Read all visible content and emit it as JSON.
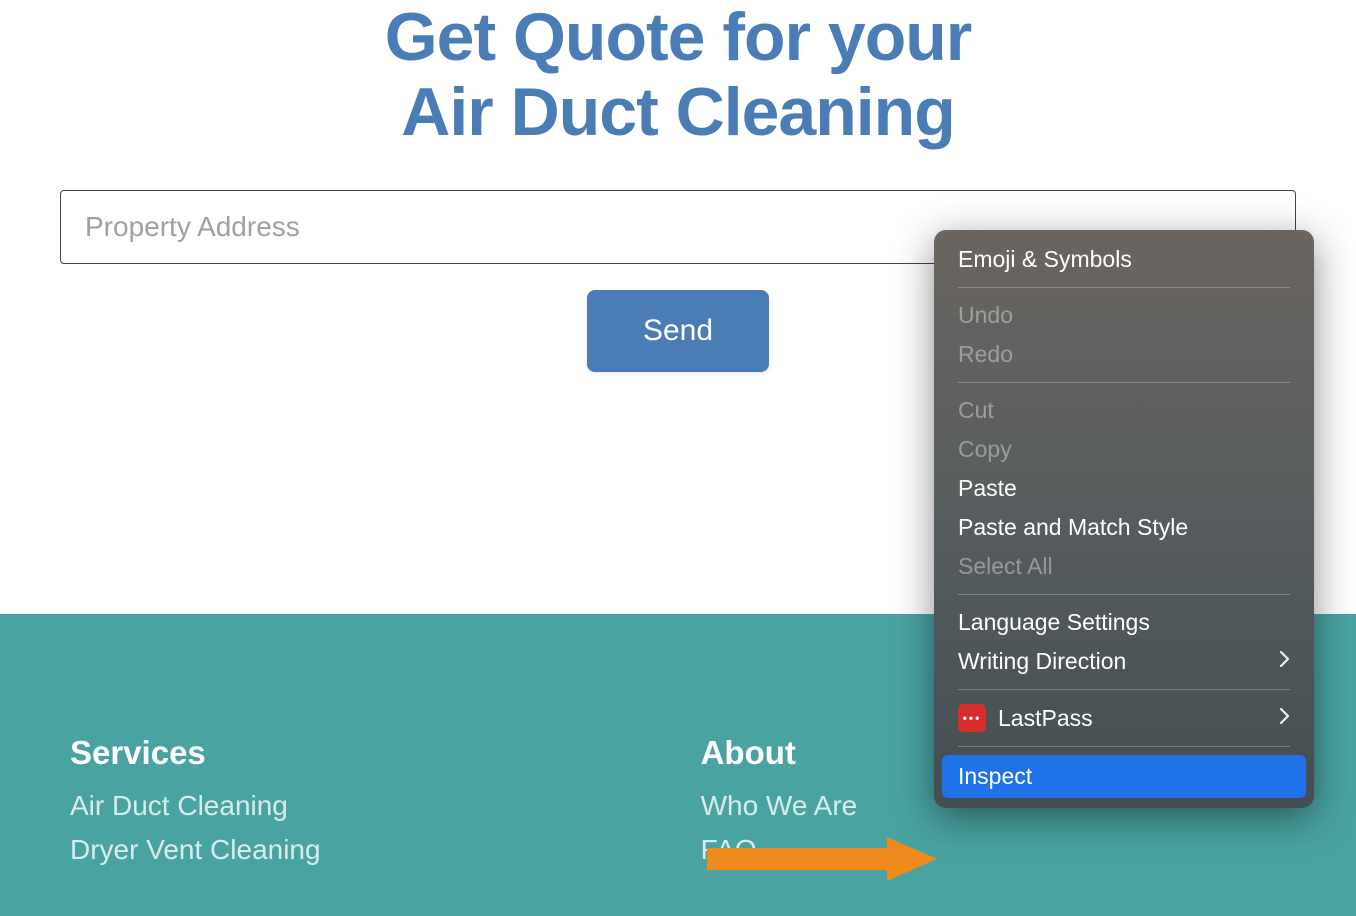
{
  "hero": {
    "title_line1": "Get Quote for your",
    "title_line2": "Air Duct Cleaning"
  },
  "form": {
    "address_placeholder": "Property Address",
    "send_label": "Send"
  },
  "footer": {
    "services": {
      "heading": "Services",
      "links": [
        "Air Duct Cleaning",
        "Dryer Vent Cleaning"
      ]
    },
    "about": {
      "heading": "About",
      "links": [
        "Who We Are",
        "FAQ"
      ]
    }
  },
  "context_menu": {
    "emoji": "Emoji & Symbols",
    "undo": "Undo",
    "redo": "Redo",
    "cut": "Cut",
    "copy": "Copy",
    "paste": "Paste",
    "paste_match": "Paste and Match Style",
    "select_all": "Select All",
    "language": "Language Settings",
    "writing_dir": "Writing Direction",
    "lastpass": "LastPass",
    "lastpass_icon_text": "•••",
    "inspect": "Inspect"
  }
}
